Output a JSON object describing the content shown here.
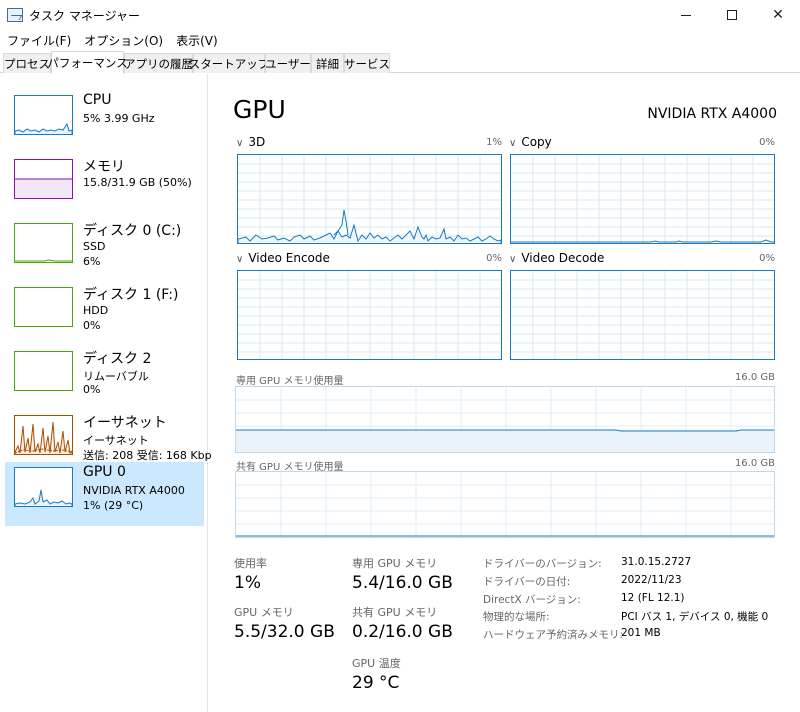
{
  "window": {
    "title": "タスク マネージャー"
  },
  "menu": [
    "ファイル(F)",
    "オプション(O)",
    "表示(V)"
  ],
  "tabs": [
    "プロセス",
    "パフォーマンス",
    "アプリの履歴",
    "スタートアップ",
    "ユーザー",
    "詳細",
    "サービス"
  ],
  "sidebar": {
    "items": [
      {
        "name": "CPU",
        "sub1": "5%  3.99 GHz",
        "sub2": "",
        "color": "#1a7abf"
      },
      {
        "name": "メモリ",
        "sub1": "15.8/31.9 GB (50%)",
        "sub2": "",
        "color": "#8b12ae"
      },
      {
        "name": "ディスク 0 (C:)",
        "sub1": "SSD",
        "sub2": "6%",
        "color": "#4da60c"
      },
      {
        "name": "ディスク 1 (F:)",
        "sub1": "HDD",
        "sub2": "0%",
        "color": "#4da60c"
      },
      {
        "name": "ディスク 2",
        "sub1": "リムーバブル",
        "sub2": "0%",
        "color": "#4da60c"
      },
      {
        "name": "イーサネット",
        "sub1": "イーサネット",
        "sub2": "送信: 208  受信: 168 Kbp",
        "color": "#a74f01"
      },
      {
        "name": "GPU 0",
        "sub1": "NVIDIA RTX A4000",
        "sub2": "1%  (29 °C)",
        "color": "#1a7abf"
      }
    ]
  },
  "main": {
    "title": "GPU",
    "model": "NVIDIA RTX A4000",
    "engines": [
      {
        "label": "3D",
        "pct": "1%"
      },
      {
        "label": "Copy",
        "pct": "0%"
      },
      {
        "label": "Video Encode",
        "pct": "0%"
      },
      {
        "label": "Video Decode",
        "pct": "0%"
      }
    ],
    "dedicated": {
      "label": "専用 GPU メモリ使用量",
      "max": "16.0 GB"
    },
    "shared": {
      "label": "共有 GPU メモリ使用量",
      "max": "16.0 GB"
    },
    "stats": {
      "usage_label": "使用率",
      "usage_value": "1%",
      "gpumem_label": "GPU メモリ",
      "gpumem_value": "5.5/32.0 GB",
      "dedicated_label": "専用 GPU メモリ",
      "dedicated_value": "5.4/16.0 GB",
      "shared_label": "共有 GPU メモリ",
      "shared_value": "0.2/16.0 GB",
      "temp_label": "GPU 温度",
      "temp_value": "29 °C"
    },
    "info": [
      {
        "key": "ドライバーのバージョン:",
        "value": "31.0.15.2727"
      },
      {
        "key": "ドライバーの日付:",
        "value": "2022/11/23"
      },
      {
        "key": "DirectX バージョン:",
        "value": "12 (FL 12.1)"
      },
      {
        "key": "物理的な場所:",
        "value": "PCI バス 1, デバイス 0, 機能 0"
      },
      {
        "key": "ハードウェア予約済みメモリ:",
        "value": "201 MB"
      }
    ]
  },
  "colors": {
    "gpu_line": "#1a7abf",
    "grid": "#d6e8f5",
    "selected_bg": "#cce8ff"
  }
}
